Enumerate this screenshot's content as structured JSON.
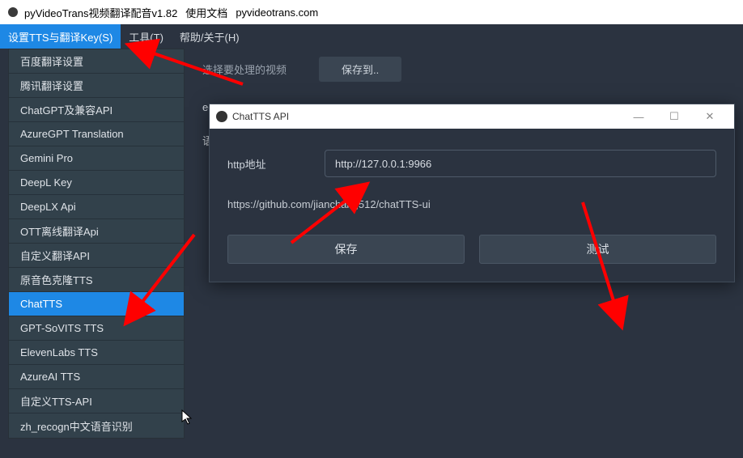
{
  "app": {
    "title": "pyVideoTrans视频翻译配音v1.82",
    "doc_label": "使用文档",
    "site": "pyvideotrans.com"
  },
  "menubar": {
    "settings": "设置TTS与翻译Key(S)",
    "tools": "工具(T)",
    "help": "帮助/关于(H)"
  },
  "dropdown": {
    "items": [
      "百度翻译设置",
      "腾讯翻译设置",
      "ChatGPT及兼容API",
      "AzureGPT Translation",
      "Gemini Pro",
      "DeepL Key",
      "DeepLX Api",
      "OTT离线翻译Api",
      "自定义翻译API",
      "原音色克隆TTS",
      "ChatTTS",
      "GPT-SoVITS TTS",
      "ElevenLabs TTS",
      "AzureAI TTS",
      "自定义TTS-API",
      "zh_recogn中文语音识别"
    ],
    "selected_index": 10
  },
  "background": {
    "trunc1": "eeGo",
    "lang": "语",
    "select_video": "选择要处理的视频",
    "save_button": "保存到.."
  },
  "dialog": {
    "title": "ChatTTS API",
    "field_label": "http地址",
    "field_value": "http://127.0.0.1:9966",
    "link": "https://github.com/jianchang512/chatTTS-ui",
    "save": "保存",
    "test": "测试"
  }
}
